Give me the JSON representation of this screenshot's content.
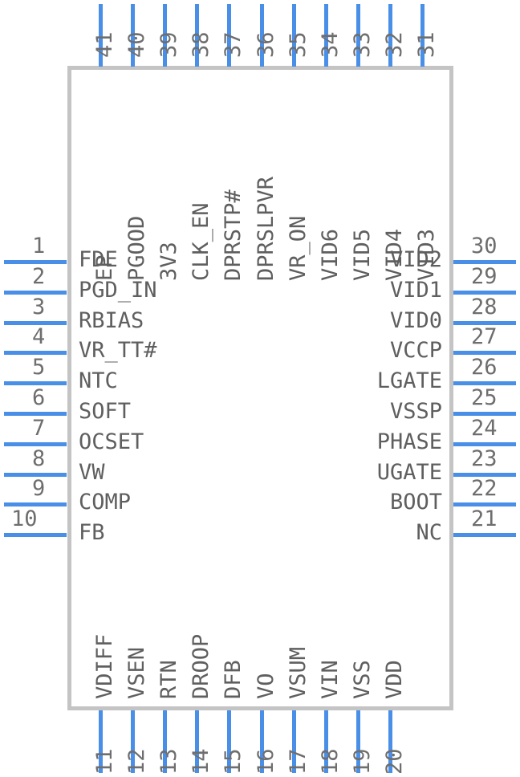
{
  "component": {
    "type": "ic-pinout-diagram",
    "package_pin_count": 41,
    "colors": {
      "lead": "#4a8fe7",
      "body_border": "#c4c4c4",
      "body_fill": "#ffffff",
      "text": "#5f5f5f",
      "pin_number_text": "#6e6e6e"
    }
  },
  "pins": {
    "top": [
      {
        "number": "41",
        "name": "EP"
      },
      {
        "number": "40",
        "name": "PGOOD"
      },
      {
        "number": "39",
        "name": "3V3"
      },
      {
        "number": "38",
        "name": ""
      },
      {
        "number": "37",
        "name": "CLK_EN"
      },
      {
        "number": "36",
        "name": "DPRSTP#"
      },
      {
        "number": "35",
        "name": "DPRSLPVR"
      },
      {
        "number": "34",
        "name": "VR_ON"
      },
      {
        "number": "33",
        "name": "VID6"
      },
      {
        "number": "32",
        "name": "VID5"
      },
      {
        "number": "31",
        "name": "VID4"
      }
    ],
    "top_extra": [
      {
        "number": "",
        "name": "VID3"
      }
    ],
    "left": [
      {
        "number": "1",
        "name": "FDE"
      },
      {
        "number": "2",
        "name": "PGD_IN"
      },
      {
        "number": "3",
        "name": "RBIAS"
      },
      {
        "number": "4",
        "name": "VR_TT#"
      },
      {
        "number": "5",
        "name": "NTC"
      },
      {
        "number": "6",
        "name": "SOFT"
      },
      {
        "number": "7",
        "name": "OCSET"
      },
      {
        "number": "8",
        "name": "VW"
      },
      {
        "number": "9",
        "name": "COMP"
      },
      {
        "number": "10",
        "name": "FB"
      }
    ],
    "right": [
      {
        "number": "30",
        "name": "VID2"
      },
      {
        "number": "29",
        "name": "VID1"
      },
      {
        "number": "28",
        "name": "VID0"
      },
      {
        "number": "27",
        "name": "VCCP"
      },
      {
        "number": "26",
        "name": "LGATE"
      },
      {
        "number": "25",
        "name": "VSSP"
      },
      {
        "number": "24",
        "name": "PHASE"
      },
      {
        "number": "23",
        "name": "UGATE"
      },
      {
        "number": "22",
        "name": "BOOT"
      },
      {
        "number": "21",
        "name": "NC"
      }
    ],
    "bottom": [
      {
        "number": "11",
        "name": "VDIFF"
      },
      {
        "number": "12",
        "name": "VSEN"
      },
      {
        "number": "13",
        "name": "RTN"
      },
      {
        "number": "14",
        "name": "DROOP"
      },
      {
        "number": "15",
        "name": "DFB"
      },
      {
        "number": "16",
        "name": "VO"
      },
      {
        "number": "17",
        "name": "VSUM"
      },
      {
        "number": "18",
        "name": "VIN"
      },
      {
        "number": "19",
        "name": "VSS"
      },
      {
        "number": "20",
        "name": "VDD"
      }
    ]
  },
  "top_labels": [
    "EP",
    "PGOOD",
    "3V3",
    "CLK_EN",
    "DPRSTP#",
    "DPRSLPVR",
    "VR_ON",
    "VID6",
    "VID5",
    "VID4",
    "VID3"
  ],
  "top_numbers": [
    "41",
    "40",
    "39",
    "38",
    "37",
    "36",
    "35",
    "34",
    "33",
    "32",
    "31"
  ]
}
